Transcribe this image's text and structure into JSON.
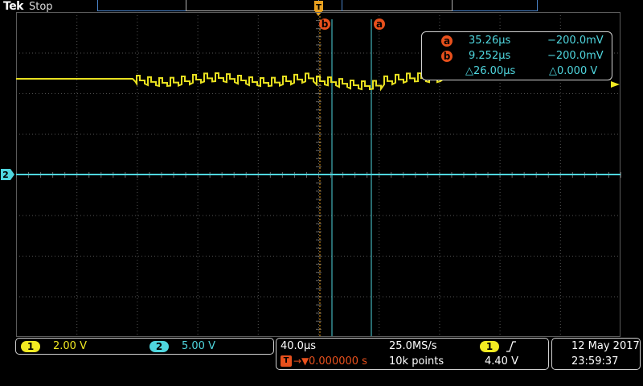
{
  "header": {
    "brand": "Tek",
    "run_state": "Stop"
  },
  "cursors": {
    "a": {
      "label": "a",
      "time": "35.26µs",
      "voltage": "−200.0mV"
    },
    "b": {
      "label": "b",
      "time": "9.252µs",
      "voltage": "−200.0mV"
    },
    "delta": {
      "time": "△26.00µs",
      "voltage": "△0.000 V"
    }
  },
  "trigger_position_marker": "T",
  "channels": {
    "ch1": {
      "number": "1",
      "scale": "2.00 V",
      "color": "#f2ea22"
    },
    "ch2": {
      "number": "2",
      "scale": "5.00 V",
      "color": "#4fd6de"
    }
  },
  "acquisition": {
    "timebase": "40.0µs",
    "sample_rate": "25.0MS/s",
    "trigger_delay": "0.000000 s",
    "record_length": "10k points",
    "trigger_source": "1",
    "trigger_slope_icon": "rising-edge-icon",
    "trigger_level": "4.40 V"
  },
  "datetime": {
    "date": "12 May 2017",
    "time": "23:59:37"
  },
  "colors": {
    "cursor": "#e8501c",
    "cursor_line": "#4fd6de",
    "grid": "#5a5a5a"
  }
}
